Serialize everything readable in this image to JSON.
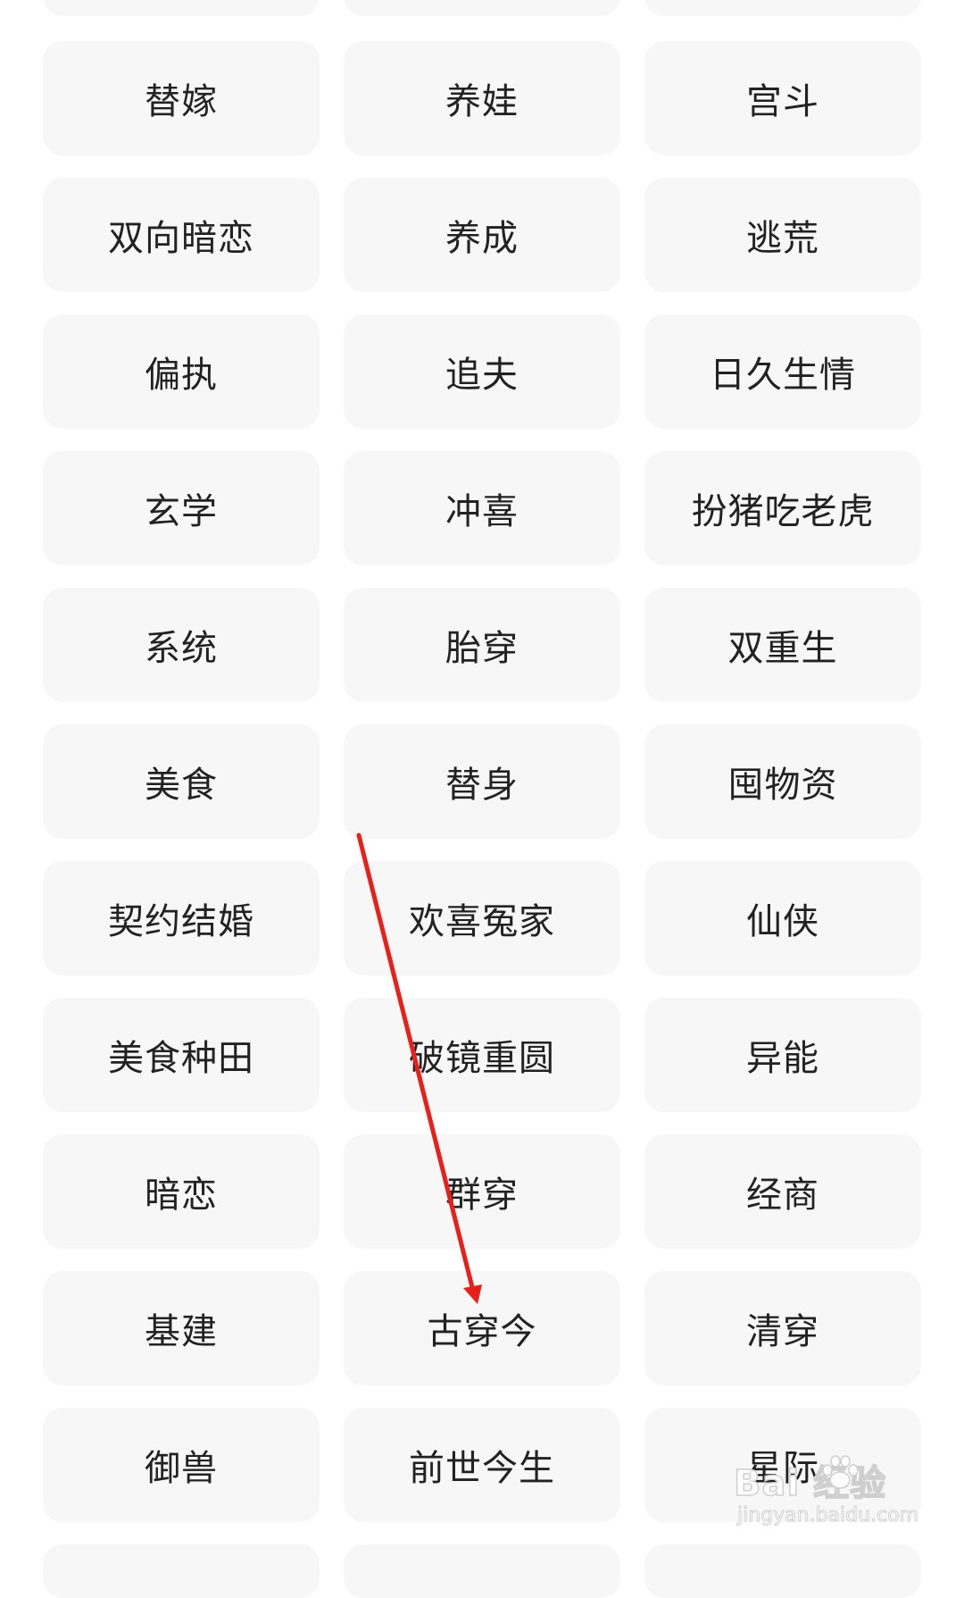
{
  "tags": [
    [
      "替嫁",
      "养娃",
      "宫斗"
    ],
    [
      "双向暗恋",
      "养成",
      "逃荒"
    ],
    [
      "偏执",
      "追夫",
      "日久生情"
    ],
    [
      "玄学",
      "冲喜",
      "扮猪吃老虎"
    ],
    [
      "系统",
      "胎穿",
      "双重生"
    ],
    [
      "美食",
      "替身",
      "囤物资"
    ],
    [
      "契约结婚",
      "欢喜冤家",
      "仙侠"
    ],
    [
      "美食种田",
      "破镜重圆",
      "异能"
    ],
    [
      "暗恋",
      "群穿",
      "经商"
    ],
    [
      "基建",
      "古穿今",
      "清穿"
    ],
    [
      "御兽",
      "前世今生",
      "星际"
    ]
  ],
  "watermark": {
    "brand": "Bai  经验",
    "url": "jingyan.baidu.com"
  },
  "colors": {
    "tag_background": "#f7f7f7",
    "tag_text": "#222222",
    "arrow": "#e8201c"
  }
}
